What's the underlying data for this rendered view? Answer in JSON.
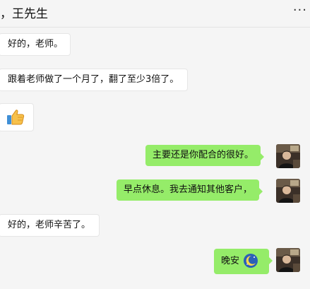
{
  "header": {
    "title": "，王先生",
    "more_label": "···",
    "more_icon": "more-dots-icon"
  },
  "messages": [
    {
      "side": "left",
      "text": "好的，老师。"
    },
    {
      "side": "left",
      "text": "跟着老师做了一个月了，翻了至少3倍了。"
    },
    {
      "side": "left",
      "emoji": "thumbs-up-icon"
    },
    {
      "side": "right",
      "text": "主要还是你配合的很好。"
    },
    {
      "side": "right",
      "text": "早点休息。我去通知其他客户，"
    },
    {
      "side": "left",
      "text": "好的，老师辛苦了。"
    },
    {
      "side": "right",
      "text": "晚安",
      "emoji": "moon-icon"
    }
  ],
  "colors": {
    "background": "#f5f5f5",
    "left_bubble": "#ffffff",
    "right_bubble": "#95ec69"
  }
}
